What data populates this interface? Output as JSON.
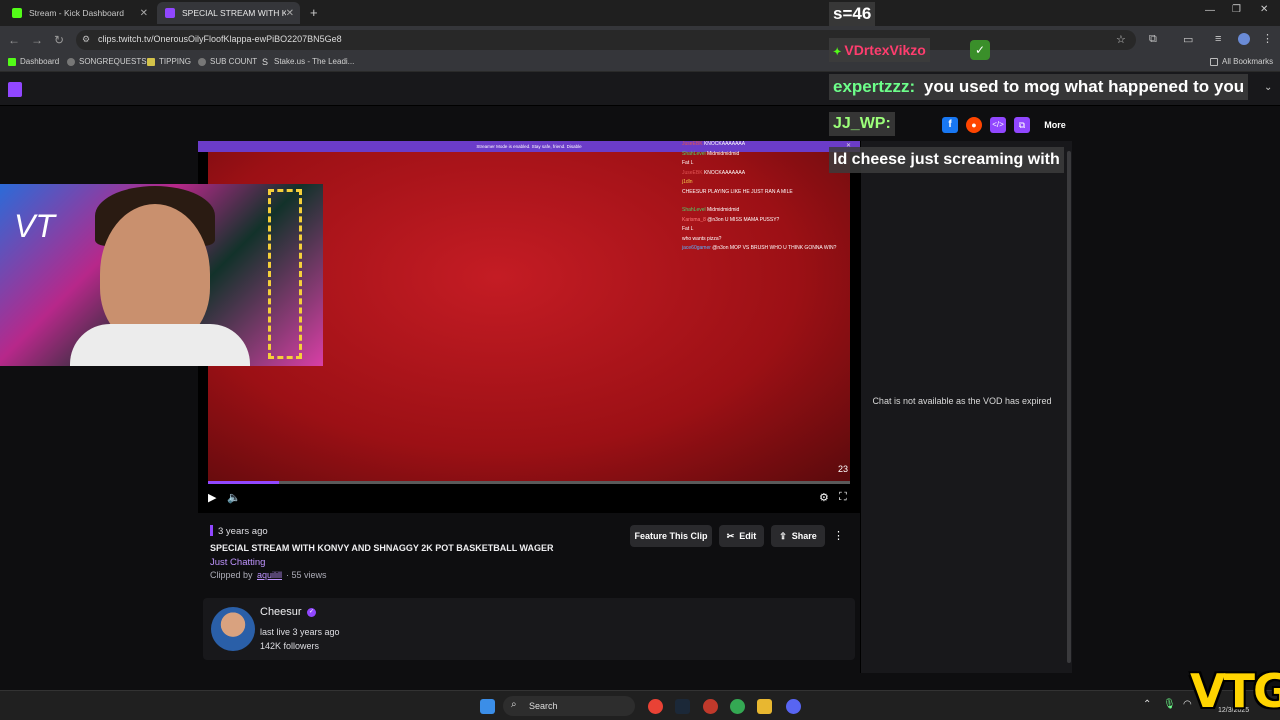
{
  "browser": {
    "tabs": [
      {
        "label": "Stream - Kick Dashboard"
      },
      {
        "label": "SPECIAL STREAM WITH KONVY"
      }
    ],
    "url": "clips.twitch.tv/OnerousOilyFloofKlappa-ewPiBO2207BN5Ge8",
    "bookmarks": [
      {
        "label": "Dashboard"
      },
      {
        "label": "SONGREQUESTS"
      },
      {
        "label": "TIPPING"
      },
      {
        "label": "SUB COUNT"
      },
      {
        "label": "Stake.us - The Leadi..."
      }
    ],
    "all_bookmarks": "All Bookmarks"
  },
  "overlay": {
    "sub_count": "s=46",
    "user1": "VDrtexVikzo",
    "user2": "expertzzz:",
    "msg2": "you used to mog what happened to you",
    "user3": "JJ_WP:",
    "msg3": "ld cheese just screaming with",
    "more_label": "More"
  },
  "player": {
    "banner": "Streamer Mode is enabled. Stay safe, friend.   Disable",
    "timecode": "23",
    "progress_fraction": 0.11,
    "chat": [
      {
        "user": "JuseEBK",
        "msg": "KNOCKAAAAAAA"
      },
      {
        "user": "ShahLevel",
        "msg": "Midmidmidmid"
      },
      {
        "user": "",
        "msg": "Fat L"
      },
      {
        "user": "JuseEBK",
        "msg": "KNOCKAAAAAAA"
      },
      {
        "user": "j1dln",
        "msg": ""
      },
      {
        "user": "",
        "msg": "CHEESUR PLAYING LIKE HE JUST RAN A MILE"
      },
      {
        "user": "ShahLevel",
        "msg": "Midmidmidmid"
      },
      {
        "user": "Karisma_8",
        "msg": "@n3on U MISS MAMA PUSSY?"
      },
      {
        "user": "",
        "msg": "Fat L"
      },
      {
        "user": "",
        "msg": "who wants pizza?"
      },
      {
        "user": "jace60gamer",
        "msg": "@n3on MOP VS BRUSH WHO U THINK GONNA WIN?"
      }
    ]
  },
  "clip": {
    "age": "3 years ago",
    "title": "SPECIAL STREAM WITH KONVY AND SHNAGGY 2K POT BASKETBALL WAGER",
    "category": "Just Chatting",
    "clipped_by_label": "Clipped by",
    "clipped_by": "aquilill",
    "views": "· 55 views",
    "feature_label": "Feature This Clip",
    "edit_label": "Edit",
    "share_label": "Share"
  },
  "streamer": {
    "name": "Cheesur",
    "last_live": "last live 3 years ago",
    "followers": "142K followers"
  },
  "chat_panel": {
    "message": "Chat is not available as the VOD has expired"
  },
  "taskbar": {
    "search_label": "Search",
    "date": "12/3/2025"
  },
  "watermark": "VTG",
  "colors": {
    "twitch_purple": "#9147ff",
    "video_red": "#b0141b",
    "overlay_yellow": "#ffd400"
  }
}
